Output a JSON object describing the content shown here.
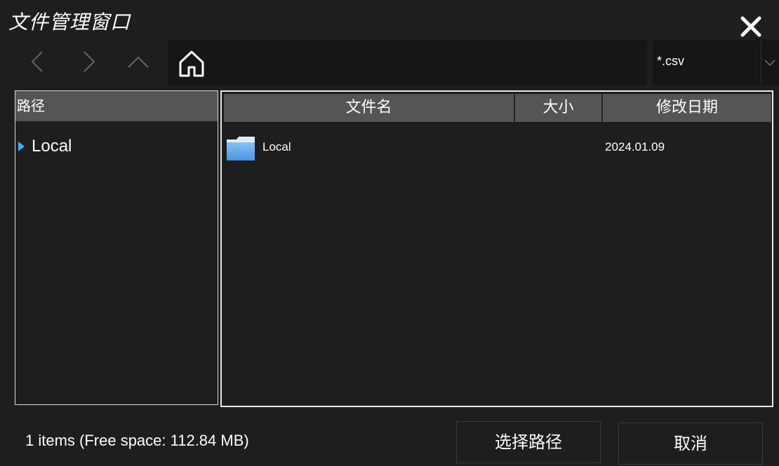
{
  "window": {
    "title": "文件管理窗口"
  },
  "icons": {
    "close": "close-icon",
    "back": "chevron-left-icon",
    "forward": "chevron-right-icon",
    "up": "chevron-up-icon",
    "home": "home-icon",
    "dropdown": "chevron-down-icon",
    "folder": "folder-icon",
    "tree_expand": "triangle-right-icon"
  },
  "toolbar": {
    "filter": {
      "value": "*.csv"
    }
  },
  "left_pane": {
    "header": "路径",
    "tree": [
      {
        "label": "Local"
      }
    ]
  },
  "file_list": {
    "columns": [
      "文件名",
      "大小",
      "修改日期"
    ],
    "rows": [
      {
        "name": "Local",
        "size": "",
        "modified": "2024.01.09",
        "type": "folder"
      }
    ]
  },
  "status": {
    "text": "1 items (Free space: 112.84 MB)"
  },
  "buttons": {
    "select_path": "选择路径",
    "cancel": "取消"
  },
  "colors": {
    "background": "#1e1e1e",
    "header": "#555555",
    "accent": "#3fa9f5",
    "folder": "#5aa2ea"
  }
}
